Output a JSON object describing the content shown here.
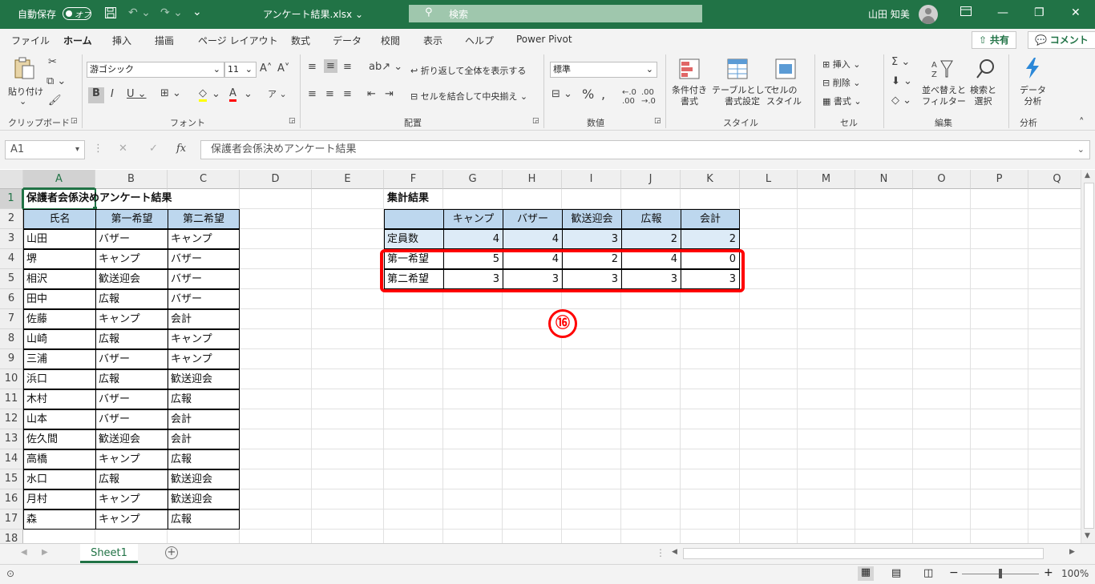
{
  "titlebar": {
    "autosave_label": "自動保存",
    "autosave_state": "オフ",
    "file_name": "アンケート結果.xlsx",
    "search_placeholder": "検索",
    "user_name": "山田 知美",
    "accent_color": "#217346"
  },
  "menu": {
    "tabs": [
      "ファイル",
      "ホーム",
      "挿入",
      "描画",
      "ページ レイアウト",
      "数式",
      "データ",
      "校閲",
      "表示",
      "ヘルプ",
      "Power Pivot"
    ],
    "active_tab": "ホーム",
    "share_label": "共有",
    "comment_label": "コメント"
  },
  "ribbon": {
    "clipboard": {
      "paste": "貼り付け",
      "label": "クリップボード"
    },
    "font": {
      "name": "游ゴシック",
      "size": "11",
      "label": "フォント"
    },
    "alignment": {
      "wrap": "折り返して全体を表示する",
      "merge": "セルを結合して中央揃え",
      "label": "配置"
    },
    "number": {
      "format": "標準",
      "label": "数値"
    },
    "styles": {
      "conditional": "条件付き\n書式",
      "table": "テーブルとして\n書式設定",
      "cell": "セルの\nスタイル",
      "label": "スタイル"
    },
    "cells": {
      "insert": "挿入",
      "delete": "削除",
      "format": "書式",
      "label": "セル"
    },
    "editing": {
      "sort": "並べ替えと\nフィルター",
      "find": "検索と\n選択",
      "label": "編集"
    },
    "analysis": {
      "data": "データ\n分析",
      "label": "分析"
    }
  },
  "formula_bar": {
    "name_box": "A1",
    "fx": "fx",
    "content": "保護者会係決めアンケート結果"
  },
  "sheet": {
    "columns": [
      "A",
      "B",
      "C",
      "D",
      "E",
      "F",
      "G",
      "H",
      "I",
      "J",
      "K",
      "L",
      "M",
      "N",
      "O",
      "P",
      "Q"
    ],
    "rows": [
      "1",
      "2",
      "3",
      "4",
      "5",
      "6",
      "7",
      "8",
      "9",
      "10",
      "11",
      "12",
      "13",
      "14",
      "15",
      "16",
      "17",
      "18"
    ],
    "title": "保護者会係決めアンケート結果",
    "headers": [
      "氏名",
      "第一希望",
      "第二希望"
    ],
    "responses": [
      [
        "山田",
        "バザー",
        "キャンプ"
      ],
      [
        "堺",
        "キャンプ",
        "バザー"
      ],
      [
        "相沢",
        "歓送迎会",
        "バザー"
      ],
      [
        "田中",
        "広報",
        "バザー"
      ],
      [
        "佐藤",
        "キャンプ",
        "会計"
      ],
      [
        "山崎",
        "広報",
        "キャンプ"
      ],
      [
        "三浦",
        "バザー",
        "キャンプ"
      ],
      [
        "浜口",
        "広報",
        "歓送迎会"
      ],
      [
        "木村",
        "バザー",
        "広報"
      ],
      [
        "山本",
        "バザー",
        "会計"
      ],
      [
        "佐久間",
        "歓送迎会",
        "会計"
      ],
      [
        "高橋",
        "キャンプ",
        "広報"
      ],
      [
        "水口",
        "広報",
        "歓送迎会"
      ],
      [
        "月村",
        "キャンプ",
        "歓送迎会"
      ],
      [
        "森",
        "キャンプ",
        "広報"
      ]
    ],
    "summary": {
      "title": "集計結果",
      "headers": [
        "キャンプ",
        "バザー",
        "歓送迎会",
        "広報",
        "会計"
      ],
      "rows": [
        {
          "label": "定員数",
          "values": [
            "4",
            "4",
            "3",
            "2",
            "2"
          ]
        },
        {
          "label": "第一希望",
          "values": [
            "5",
            "4",
            "2",
            "4",
            "0"
          ]
        },
        {
          "label": "第二希望",
          "values": [
            "3",
            "3",
            "3",
            "3",
            "3"
          ]
        }
      ]
    },
    "annotation": "⑯",
    "annotation_color": "#ff0000"
  },
  "sheet_tabs": {
    "active": "Sheet1"
  },
  "status": {
    "zoom": "100%"
  }
}
